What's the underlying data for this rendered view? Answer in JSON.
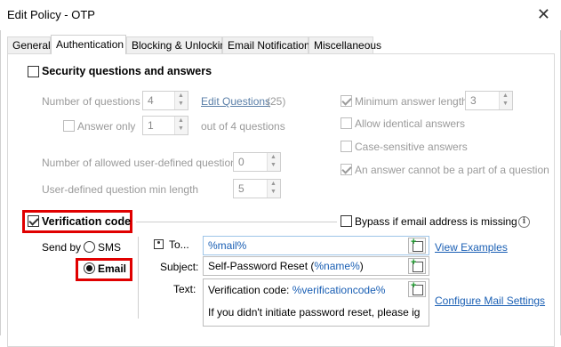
{
  "window": {
    "title": "Edit Policy - OTP"
  },
  "tabs": [
    {
      "label": "General"
    },
    {
      "label": "Authentication"
    },
    {
      "label": "Blocking & Unlocking"
    },
    {
      "label": "Email Notifications"
    },
    {
      "label": "Miscellaneous"
    }
  ],
  "security_questions": {
    "label": "Security questions and answers",
    "checked": false,
    "num_questions_label": "Number of questions",
    "num_questions_value": "4",
    "edit_questions_link": "Edit Questions",
    "edit_questions_count": "(25)",
    "answer_only_label": "Answer only",
    "answer_only_value": "1",
    "out_of_label": "out of 4 questions",
    "user_defined_label": "Number of allowed user-defined questions",
    "user_defined_value": "0",
    "min_length_label": "User-defined question min length",
    "min_length_value": "5",
    "min_answer_label": "Minimum answer length",
    "min_answer_value": "3",
    "allow_identical_label": "Allow identical answers",
    "case_sensitive_label": "Case-sensitive answers",
    "not_part_label": "An answer cannot be a part of a question"
  },
  "verification": {
    "label": "Verification code",
    "checked": true,
    "bypass_label": "Bypass if email address is missing",
    "send_by_label": "Send by",
    "sms_label": "SMS",
    "email_label": "Email",
    "selected": "Email",
    "to_label": "To...",
    "to_value": "%mail%",
    "view_examples": "View Examples",
    "subject_label": "Subject:",
    "subject_prefix": "Self-Password Reset (",
    "subject_var": "%name%",
    "subject_suffix": ")",
    "text_label": "Text:",
    "text_line1_prefix": "Verification code: ",
    "text_line1_var": "%verificationcode%",
    "text_line2": "If you didn't initiate password reset, please ig",
    "configure_mail": "Configure Mail Settings"
  },
  "colors": {
    "highlight": "#e00000",
    "link": "#1a5fb4"
  }
}
